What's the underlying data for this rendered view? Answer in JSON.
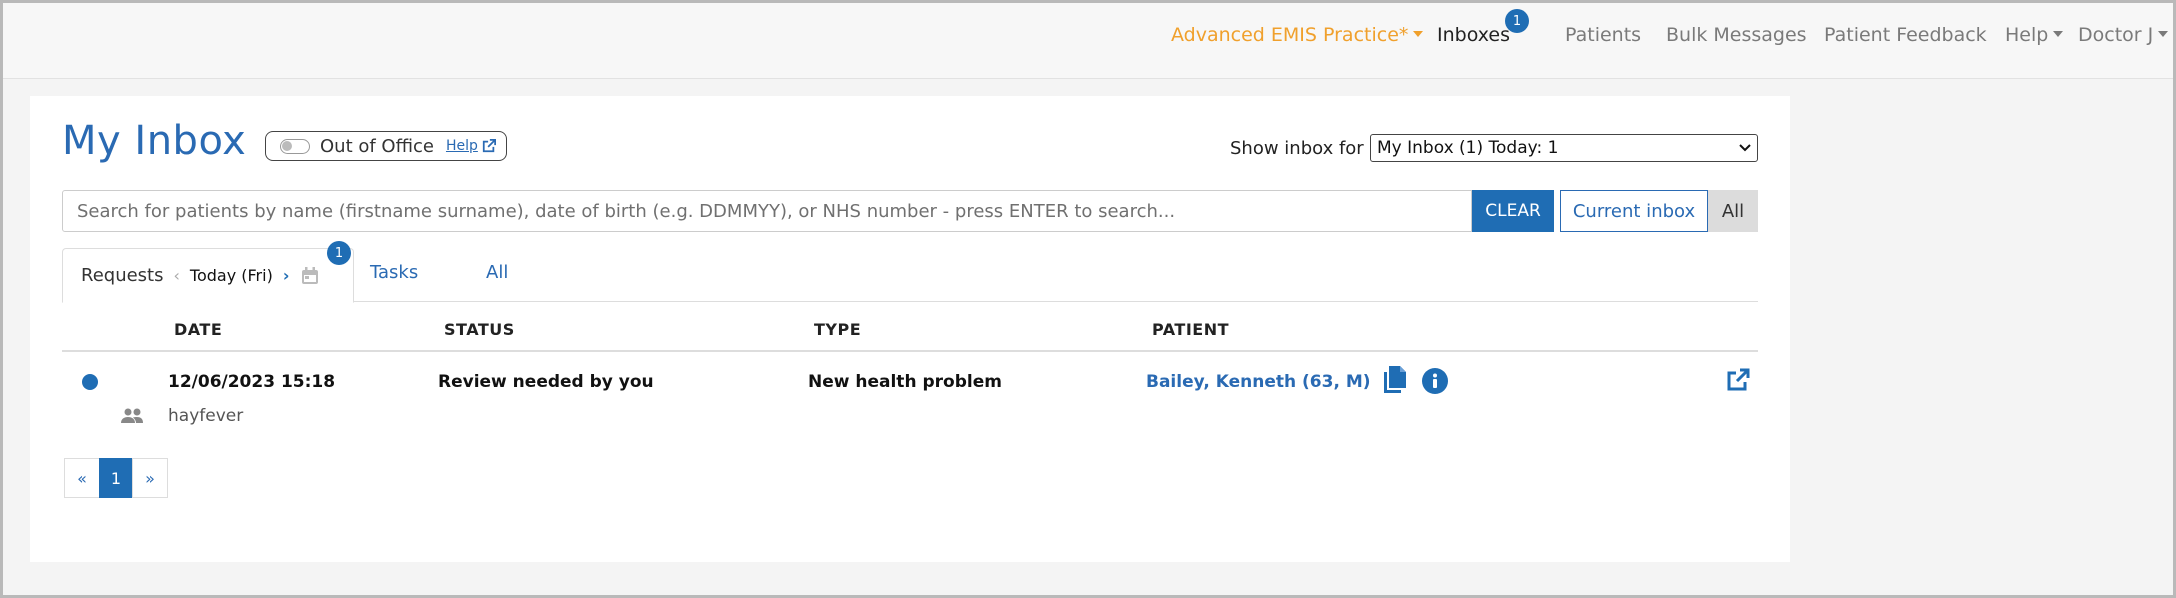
{
  "topnav": {
    "practice": "Advanced EMIS Practice*",
    "inboxes": "Inboxes",
    "inboxes_badge": "1",
    "patients": "Patients",
    "bulk_messages": "Bulk Messages",
    "patient_feedback": "Patient Feedback",
    "help": "Help",
    "user": "Doctor J"
  },
  "header": {
    "title": "My Inbox",
    "out_of_office": "Out of Office",
    "help_link": "Help",
    "show_inbox_label": "Show inbox for",
    "show_inbox_value": "My Inbox (1) Today: 1"
  },
  "search": {
    "placeholder": "Search for patients by name (firstname surname), date of birth (e.g. DDMMYY), or NHS number - press ENTER to search...",
    "clear_label": "CLEAR",
    "current_inbox_label": "Current inbox",
    "all_label": "All"
  },
  "tabs": {
    "requests": "Requests",
    "day": "Today (Fri)",
    "requests_badge": "1",
    "tasks": "Tasks",
    "all": "All"
  },
  "table": {
    "headers": [
      "DATE",
      "STATUS",
      "TYPE",
      "PATIENT"
    ],
    "rows": [
      {
        "date": "12/06/2023 15:18",
        "status": "Review needed by you",
        "type": "New health problem",
        "patient": "Bailey, Kenneth (63, M)",
        "note": "hayfever"
      }
    ]
  },
  "pagination": {
    "prev": "«",
    "current": "1",
    "next": "»"
  },
  "colors": {
    "primary": "#1f6db4",
    "practice": "#f0a02c",
    "title": "#2a6ab3"
  },
  "icons": [
    "calendar-icon",
    "people-icon",
    "document-icon",
    "info-icon",
    "external-link-icon"
  ]
}
